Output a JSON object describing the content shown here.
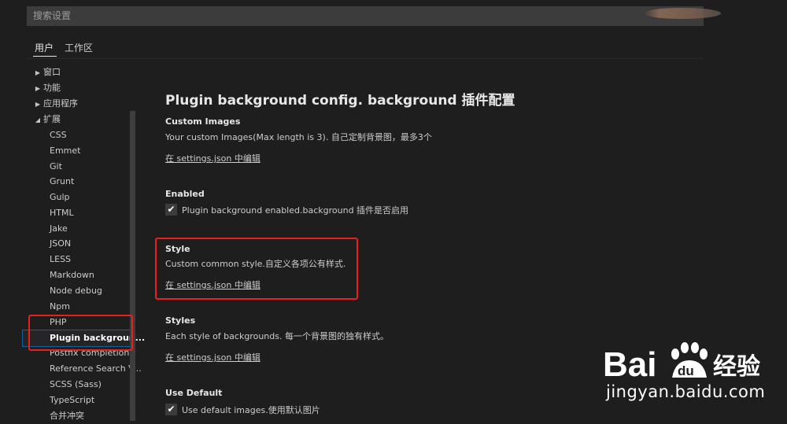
{
  "search": {
    "placeholder": "搜索设置"
  },
  "tabs": [
    {
      "label": "用户",
      "active": true
    },
    {
      "label": "工作区",
      "active": false
    }
  ],
  "tree": {
    "top_level": [
      {
        "label": "窗口",
        "expanded": false
      },
      {
        "label": "功能",
        "expanded": false
      },
      {
        "label": "应用程序",
        "expanded": false
      },
      {
        "label": "扩展",
        "expanded": true
      }
    ],
    "extensions": [
      {
        "label": "CSS"
      },
      {
        "label": "Emmet"
      },
      {
        "label": "Git"
      },
      {
        "label": "Grunt"
      },
      {
        "label": "Gulp"
      },
      {
        "label": "HTML"
      },
      {
        "label": "Jake"
      },
      {
        "label": "JSON"
      },
      {
        "label": "LESS"
      },
      {
        "label": "Markdown"
      },
      {
        "label": "Node debug"
      },
      {
        "label": "Npm"
      },
      {
        "label": "PHP"
      },
      {
        "label": "Plugin backgroun..."
      },
      {
        "label": "Postfix completion"
      },
      {
        "label": "Reference Search V..."
      },
      {
        "label": "SCSS (Sass)"
      },
      {
        "label": "TypeScript"
      },
      {
        "label": "合并冲突"
      }
    ],
    "selected": "Plugin backgroun..."
  },
  "main": {
    "title": "Plugin background config. background 插件配置",
    "settings": [
      {
        "title": "Custom Images",
        "description": "Your custom Images(Max length is 3). 自己定制背景图，最多3个",
        "link": "在 settings.json 中编辑"
      },
      {
        "title": "Enabled",
        "checkbox_label": "Plugin background enabled.background 插件是否启用",
        "checked": true
      },
      {
        "title": "Style",
        "description": "Custom common style.自定义各项公有样式.",
        "link": "在 settings.json 中编辑"
      },
      {
        "title": "Styles",
        "description": "Each style of backgrounds. 每一个背景图的独有样式。",
        "link": "在 settings.json 中编辑"
      },
      {
        "title": "Use Default",
        "checkbox_label": "Use default images.使用默认图片",
        "checked": true
      }
    ]
  },
  "watermark": {
    "logo_text_latin": "Bai",
    "logo_text_du": "du",
    "logo_text_cn": "经验",
    "url": "jingyan.baidu.com"
  },
  "colors": {
    "background": "#1e1e1e",
    "highlight_red": "#e8201c",
    "selection_border": "#0e639c"
  }
}
